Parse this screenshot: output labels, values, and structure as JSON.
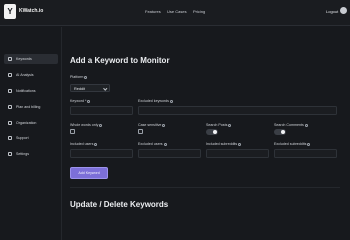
{
  "app": {
    "logo_letter": "Y",
    "name": "KWatch.io"
  },
  "topnav": {
    "features": "Features",
    "use_cases": "Use Cases",
    "pricing": "Pricing",
    "logout": "Logout"
  },
  "sidebar": {
    "items": [
      {
        "label": "Keywords",
        "icon": "list-icon",
        "active": true
      },
      {
        "label": "AI Analysis",
        "icon": "sparkle-icon",
        "active": false
      },
      {
        "label": "Notifications",
        "icon": "bell-icon",
        "active": false
      },
      {
        "label": "Plan and billing",
        "icon": "card-icon",
        "active": false
      },
      {
        "label": "Organization",
        "icon": "org-icon",
        "active": false
      },
      {
        "label": "Support",
        "icon": "support-icon",
        "active": false
      },
      {
        "label": "Settings",
        "icon": "gear-icon",
        "active": false
      }
    ]
  },
  "form": {
    "title": "Add a Keyword to Monitor",
    "platform_label": "Platform",
    "platform_value": "Reddit",
    "keyword_label": "Keyword *",
    "excluded_keywords_label": "Excluded keywords",
    "whole_words_label": "Whole words only",
    "case_sensitive_label": "Case sensitive",
    "search_posts_label": "Search Posts",
    "search_comments_label": "Search Comments",
    "included_users_label": "Included users",
    "excluded_users_label": "Excluded users",
    "included_subreddits_label": "Included subreddits",
    "excluded_subreddits_label": "Excluded subreddits",
    "search_posts_on": true,
    "search_comments_on": true,
    "add_button": "Add Keyword"
  },
  "section2": {
    "title": "Update / Delete Keywords"
  },
  "colors": {
    "accent": "#7c6fd8",
    "background": "#17191d"
  }
}
